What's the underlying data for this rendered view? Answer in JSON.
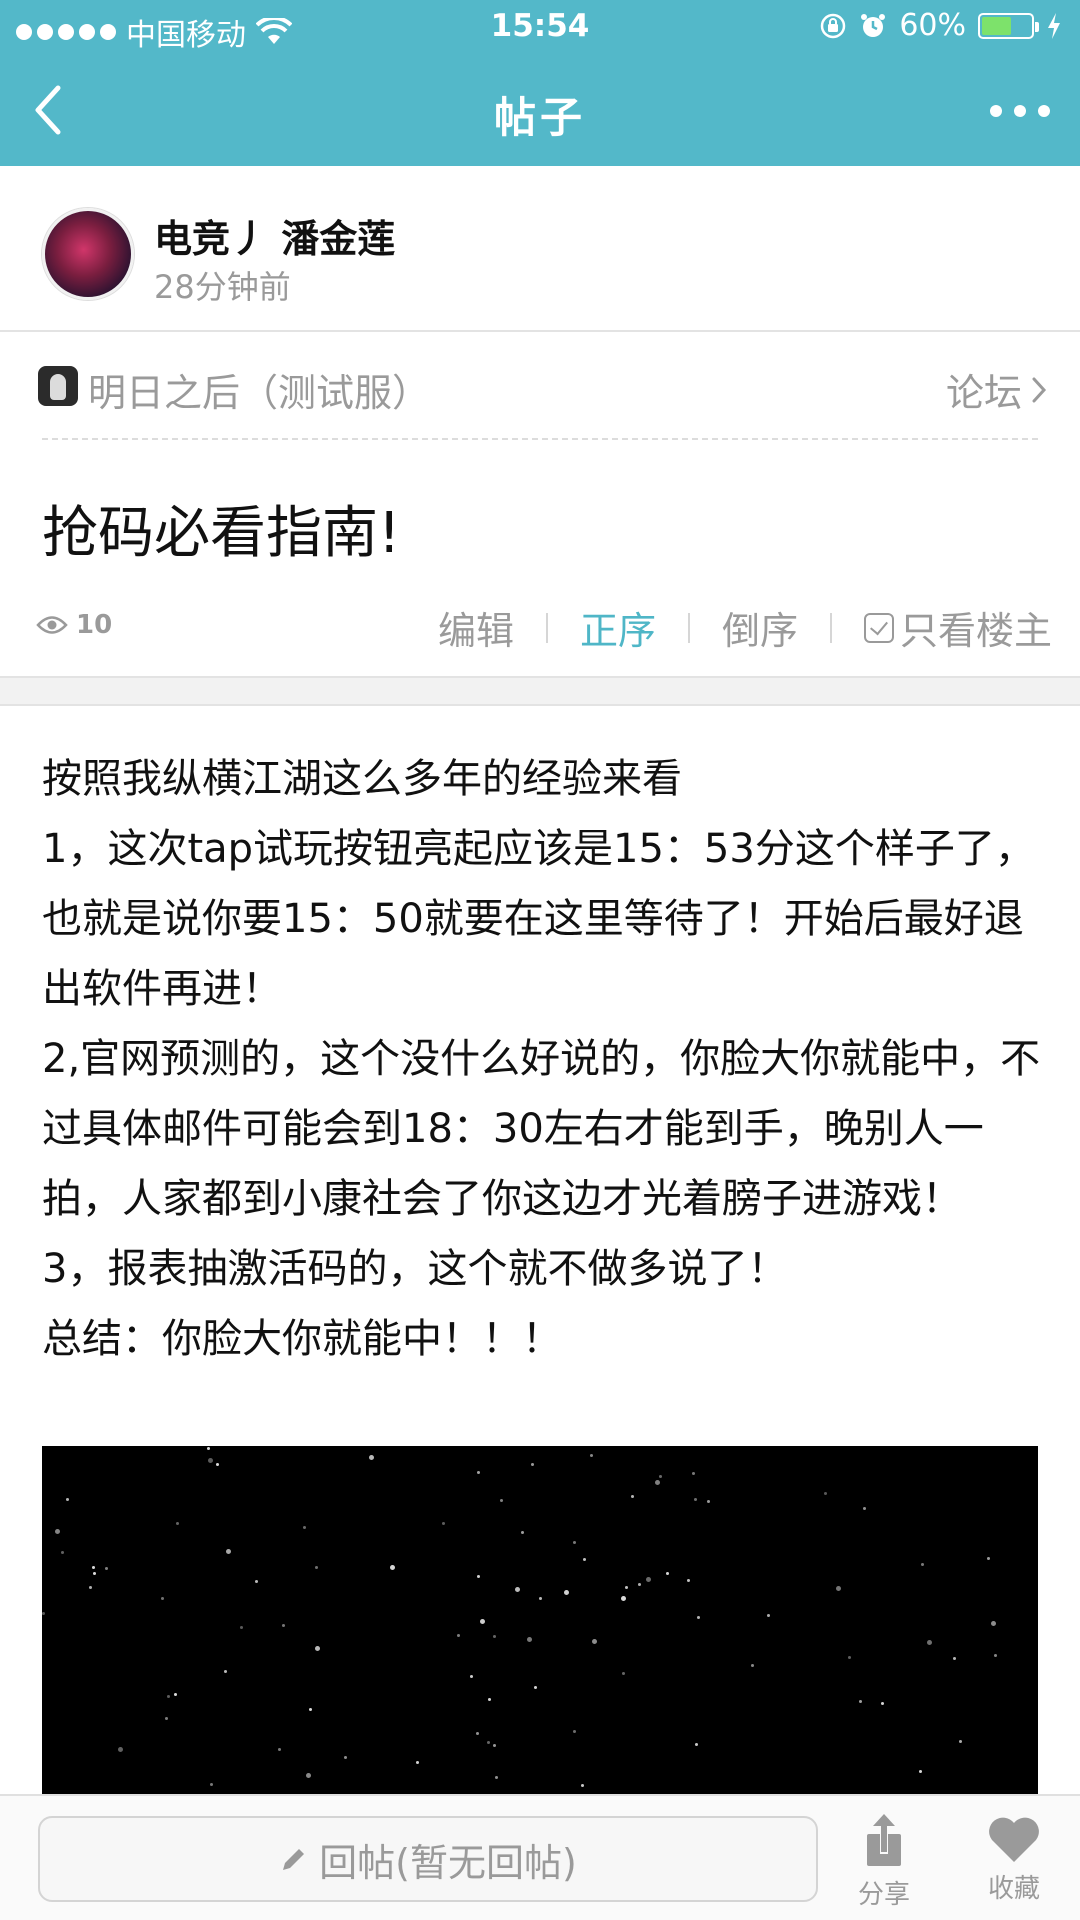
{
  "status_bar": {
    "carrier": "中国移动",
    "time": "15:54",
    "battery": "60%",
    "battery_level": 0.6
  },
  "nav": {
    "title": "帖子"
  },
  "author": {
    "name": "电竞丿 潘金莲",
    "time": "28分钟前"
  },
  "forum": {
    "name": "明日之后（测试服）",
    "link_label": "论坛"
  },
  "post": {
    "title": "抢码必看指南!",
    "views": "10",
    "actions": {
      "edit": "编辑",
      "order_asc": "正序",
      "order_desc": "倒序",
      "only_author": "只看楼主"
    },
    "body": [
      "按照我纵横江湖这么多年的经验来看",
      "1，这次tap试玩按钮亮起应该是15：53分这个样子了，也就是说你要15：50就要在这里等待了！开始后最好退出软件再进！",
      "2,官网预测的，这个没什么好说的，你脸大你就能中，不过具体邮件可能会到18：30左右才能到手，晚别人一拍，人家都到小康社会了你这边才光着膀子进游戏！",
      "3，报表抽激活码的，这个就不做多说了！",
      "总结：你脸大你就能中！！！"
    ]
  },
  "bottom_bar": {
    "reply_placeholder": "回帖(暂无回帖)",
    "share_label": "分享",
    "favorite_label": "收藏"
  },
  "colors": {
    "accent": "#53b8c9",
    "active_text": "#4fb6c7"
  }
}
